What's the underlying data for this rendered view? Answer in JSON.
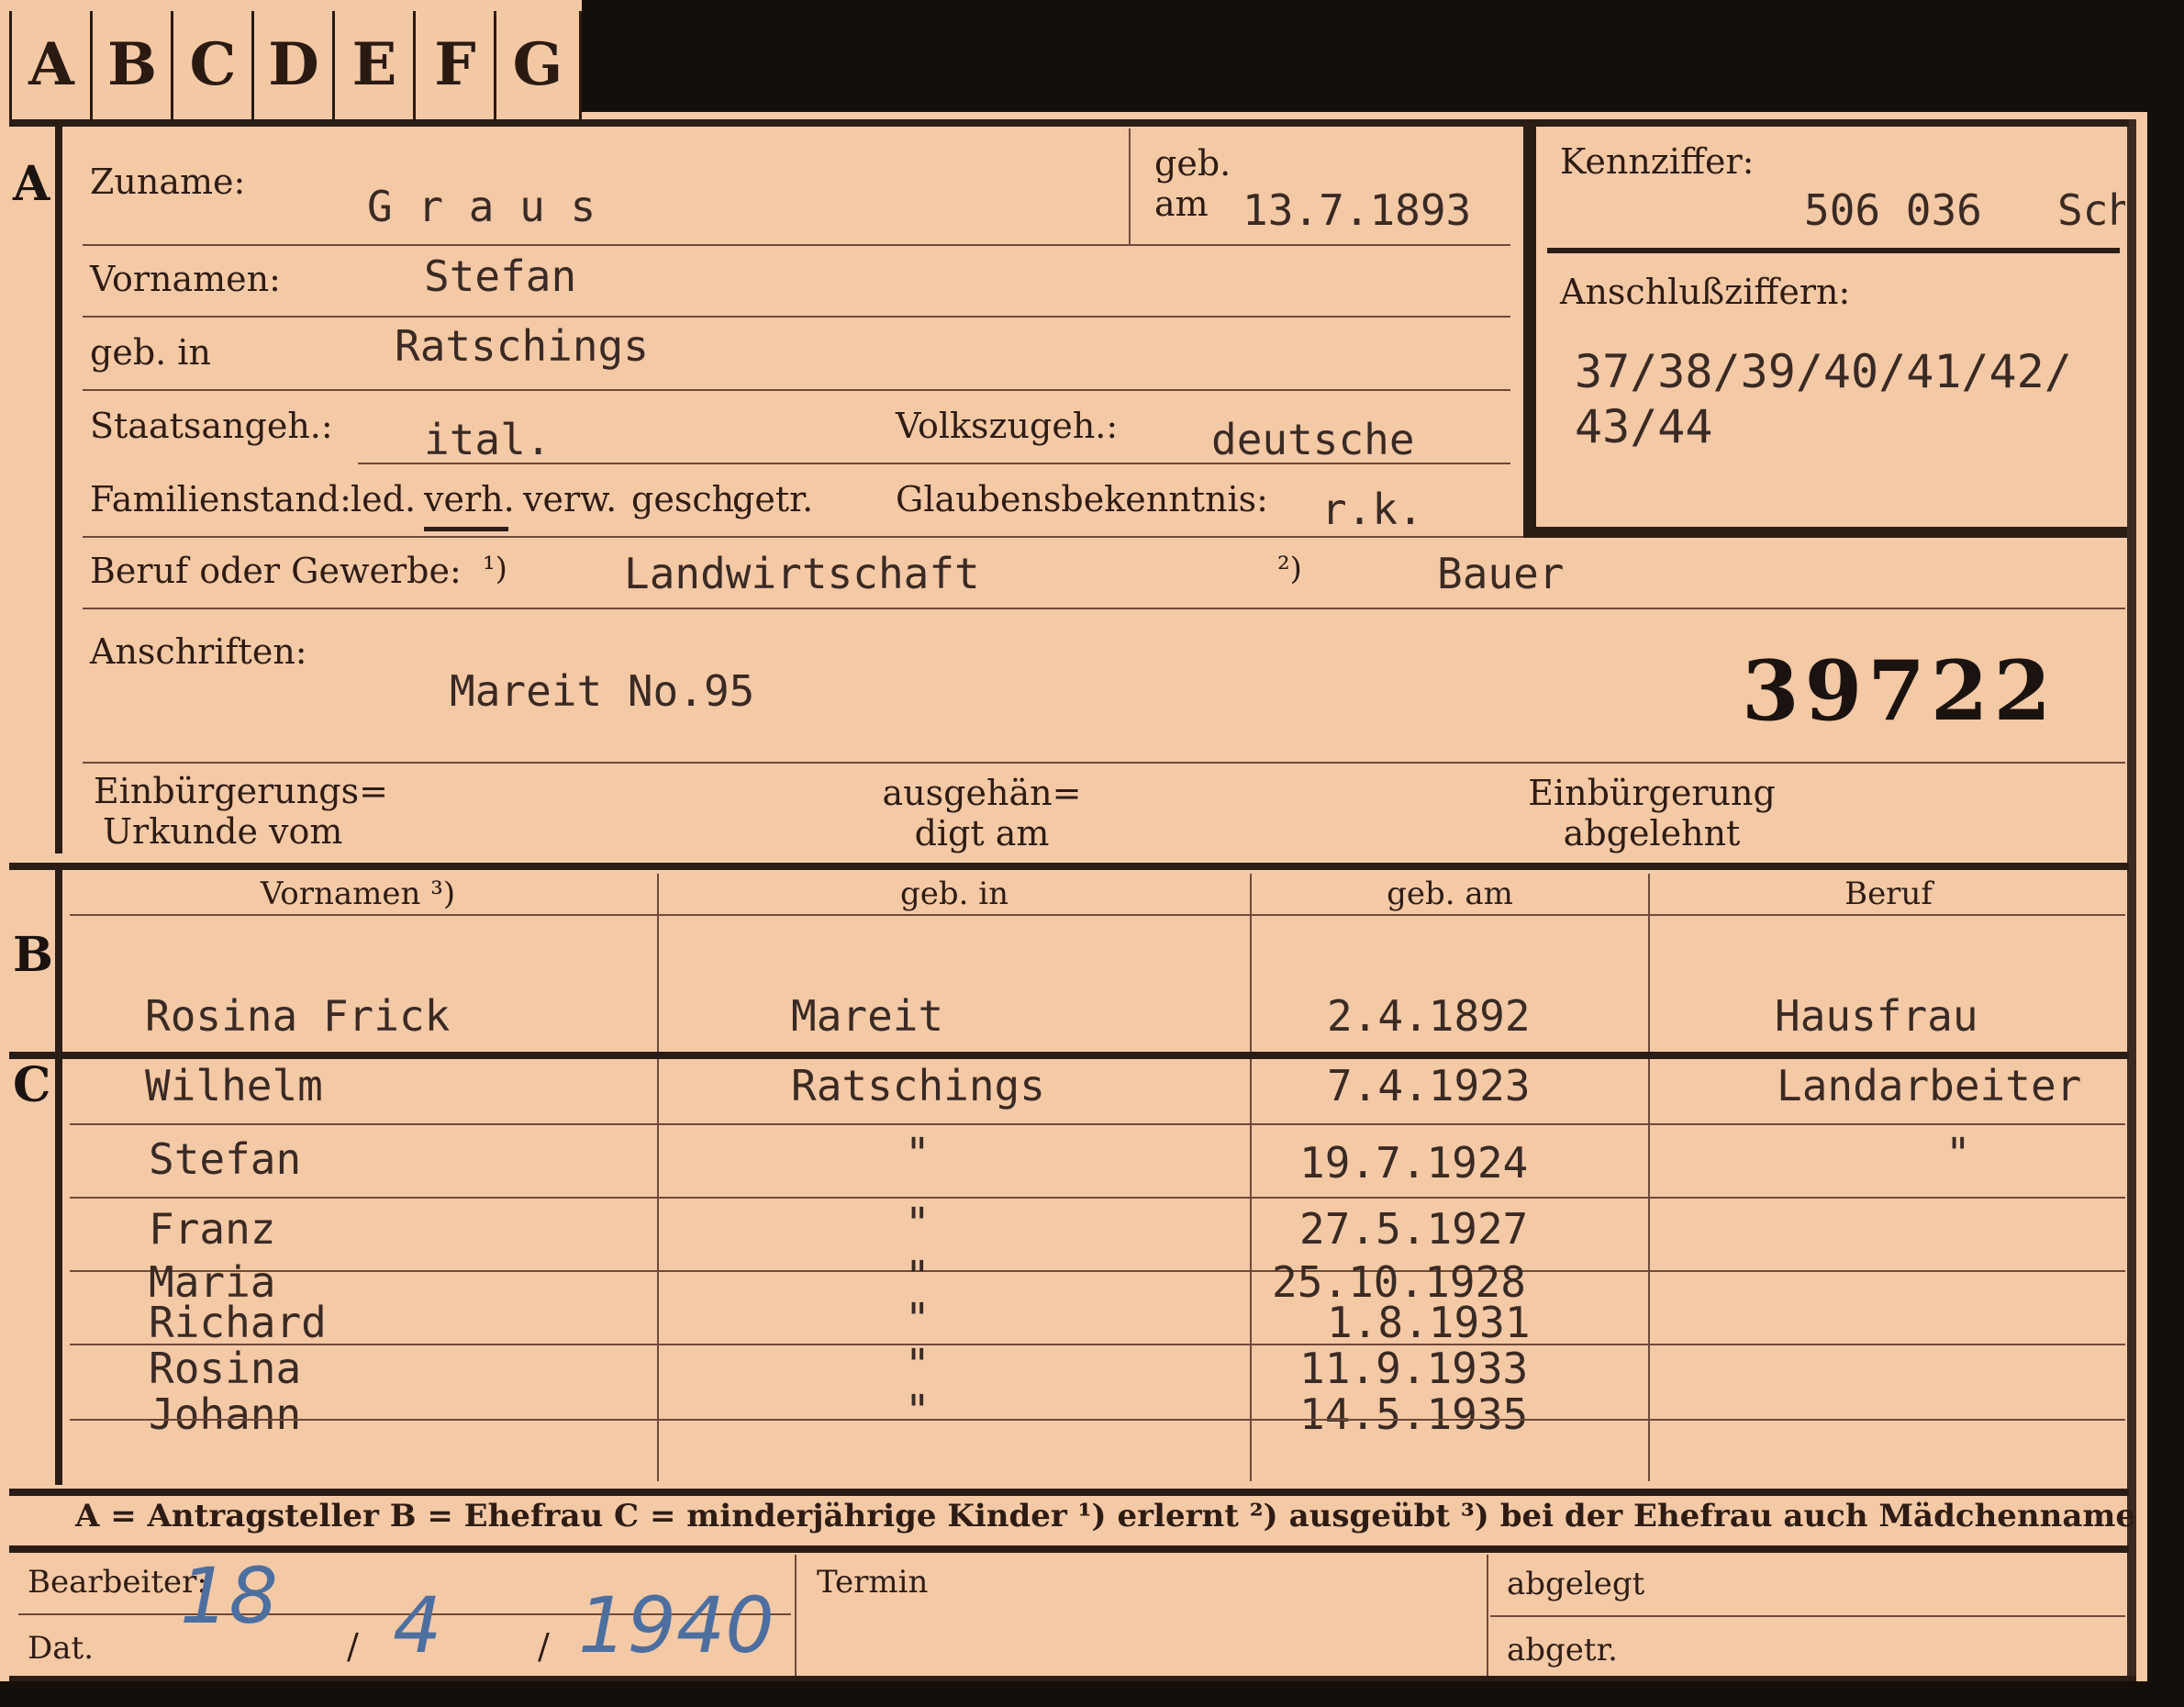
{
  "tabs": [
    "A",
    "B",
    "C",
    "D",
    "E",
    "F",
    "G"
  ],
  "section_a": {
    "letter": "A",
    "zuname_label": "Zuname:",
    "zuname": "G r a u s",
    "geb_label_1": "geb.",
    "geb_label_2": "am",
    "geb_am": "13.7.1893",
    "kennziffer_label": "Kennziffer:",
    "kennziffer": "506 036",
    "kennziffer_suffix": "Sch",
    "vornamen_label": "Vornamen:",
    "vornamen": "Stefan",
    "geb_in_label": "geb. in",
    "geb_in": "Ratschings",
    "anschluss_label": "Anschlußziffern:",
    "anschluss_1": "37/38/39/40/41/42/",
    "anschluss_2": "43/44",
    "staats_label": "Staatsangeh.:",
    "staats": "ital.",
    "volks_label": "Volkszugeh.:",
    "volks": "deutsche",
    "familien_label": "Familienstand:",
    "familien_options": [
      "led.",
      "verh.",
      "verw.",
      "gesch.",
      "getr."
    ],
    "familien_selected": "verh.",
    "glauben_label": "Glaubensbekenntnis:",
    "glauben": "r.k.",
    "beruf_label": "Beruf oder Gewerbe:",
    "beruf_note1": "¹)",
    "beruf_1": "Landwirtschaft",
    "beruf_note2": "²)",
    "beruf_2": "Bauer",
    "anschriften_label": "Anschriften:",
    "anschrift": "Mareit  No.95",
    "number": "39722",
    "einb_label_1": "Einbürgerungs=",
    "einb_label_2": "Urkunde vom",
    "ausg_label_1": "ausgehän=",
    "ausg_label_2": "digt am",
    "abgel_label_1": "Einbürgerung",
    "abgel_label_2": "abgelehnt"
  },
  "section_b": {
    "letter": "B",
    "headers": [
      "Vornamen ³)",
      "geb. in",
      "geb. am",
      "Beruf"
    ],
    "row": {
      "name": "Rosina  Frick",
      "place": "Mareit",
      "date": "2.4.1892",
      "job": "Hausfrau"
    }
  },
  "section_c": {
    "letter": "C",
    "rows": [
      {
        "name": "Wilhelm",
        "place": "Ratschings",
        "date": "7.4.1923",
        "job": "Landarbeiter"
      },
      {
        "name": "Stefan",
        "place": "\"",
        "date": "19.7.1924",
        "job": "\""
      },
      {
        "name": "Franz",
        "place": "\"",
        "date": "27.5.1927",
        "job": ""
      },
      {
        "name": "Maria",
        "place": "\"",
        "date": "25.10.1928",
        "job": ""
      },
      {
        "name": "Richard",
        "place": "\"",
        "date": "1.8.1931",
        "job": ""
      },
      {
        "name": "Rosina",
        "place": "\"",
        "date": "11.9.1933",
        "job": ""
      },
      {
        "name": "Johann",
        "place": "\"",
        "date": "14.5.1935",
        "job": ""
      }
    ]
  },
  "legend": "A = Antragsteller   B = Ehefrau   C = minderjährige Kinder   ¹) erlernt   ²) ausgeübt   ³) bei der Ehefrau auch Mädchenname",
  "footer": {
    "bearbeiter_label": "Bearbeiter:",
    "dat_label": "Dat.",
    "date_day": "18",
    "date_month": "4",
    "date_year": "1940",
    "sep": "/",
    "termin_label": "Termin",
    "abgelegt_label": "abgelegt",
    "abgetr_label": "abgetr."
  }
}
